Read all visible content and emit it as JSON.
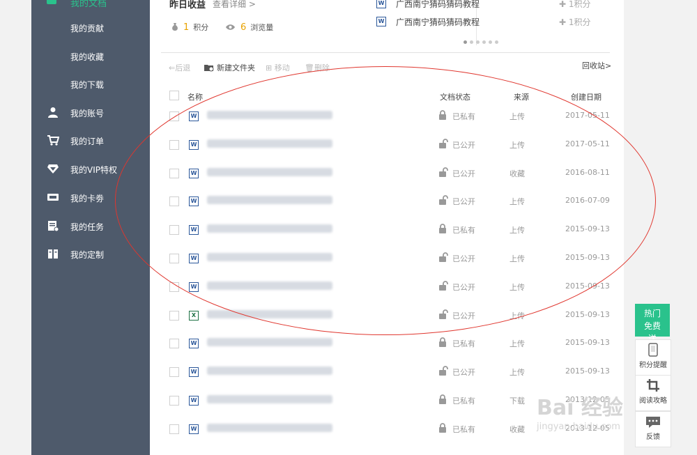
{
  "sidebar": {
    "current_label": "我的文档",
    "items": [
      {
        "label": "我的贡献",
        "icon": ""
      },
      {
        "label": "我的收藏",
        "icon": ""
      },
      {
        "label": "我的下载",
        "icon": ""
      },
      {
        "label": "我的账号",
        "icon": "user-icon"
      },
      {
        "label": "我的订单",
        "icon": "cart-icon"
      },
      {
        "label": "我的VIP特权",
        "icon": "diamond-icon"
      },
      {
        "label": "我的卡劵",
        "icon": "ticket-icon"
      },
      {
        "label": "我的任务",
        "icon": "task-icon"
      },
      {
        "label": "我的定制",
        "icon": "custom-icon"
      }
    ]
  },
  "earnings": {
    "title": "昨日收益",
    "detail_link": "查看详细 >",
    "points_value": "1",
    "points_label": "积分",
    "views_value": "6",
    "views_label": "浏览量"
  },
  "promos": [
    {
      "title": "广西南宁猜码猜码教程",
      "points": "1积分"
    },
    {
      "title": "广西南宁猜码猜码教程",
      "points": "1积分"
    }
  ],
  "toolbar": {
    "back": "后退",
    "new_folder": "新建文件夹",
    "move": "移动",
    "delete": "删除",
    "recycle": "回收站>"
  },
  "table": {
    "headers": {
      "name": "名称",
      "status": "文档状态",
      "source": "来源",
      "date": "创建日期"
    },
    "rows": [
      {
        "type": "W",
        "status": "已私有",
        "private": true,
        "source": "上传",
        "date": "2017-05-11"
      },
      {
        "type": "W",
        "status": "已公开",
        "private": false,
        "source": "上传",
        "date": "2017-05-11"
      },
      {
        "type": "W",
        "status": "已公开",
        "private": false,
        "source": "收藏",
        "date": "2016-08-11"
      },
      {
        "type": "W",
        "status": "已公开",
        "private": false,
        "source": "上传",
        "date": "2016-07-09"
      },
      {
        "type": "W",
        "status": "已私有",
        "private": true,
        "source": "上传",
        "date": "2015-09-13"
      },
      {
        "type": "W",
        "status": "已公开",
        "private": false,
        "source": "上传",
        "date": "2015-09-13"
      },
      {
        "type": "W",
        "status": "已公开",
        "private": false,
        "source": "上传",
        "date": "2015-09-13"
      },
      {
        "type": "X",
        "status": "已公开",
        "private": false,
        "source": "上传",
        "date": "2015-09-13"
      },
      {
        "type": "W",
        "status": "已私有",
        "private": true,
        "source": "上传",
        "date": "2015-09-13"
      },
      {
        "type": "W",
        "status": "已公开",
        "private": false,
        "source": "上传",
        "date": "2015-09-13"
      },
      {
        "type": "W",
        "status": "已私有",
        "private": true,
        "source": "下载",
        "date": "2013-12-05"
      },
      {
        "type": "W",
        "status": "已私有",
        "private": true,
        "source": "收藏",
        "date": "2013-12-05"
      }
    ]
  },
  "float_bar": {
    "hot": "热门免费送",
    "points_remind": "积分提醒",
    "reading_guide": "阅读攻略",
    "feedback": "反馈"
  },
  "watermark": {
    "main": "Bai 经验",
    "url": "jingyan.baidu.com"
  },
  "colors": {
    "brand_green": "#2ac28c",
    "sidebar_bg": "#4e5a6b",
    "annotation_red": "#e0362e",
    "points_orange": "#e8a200"
  }
}
